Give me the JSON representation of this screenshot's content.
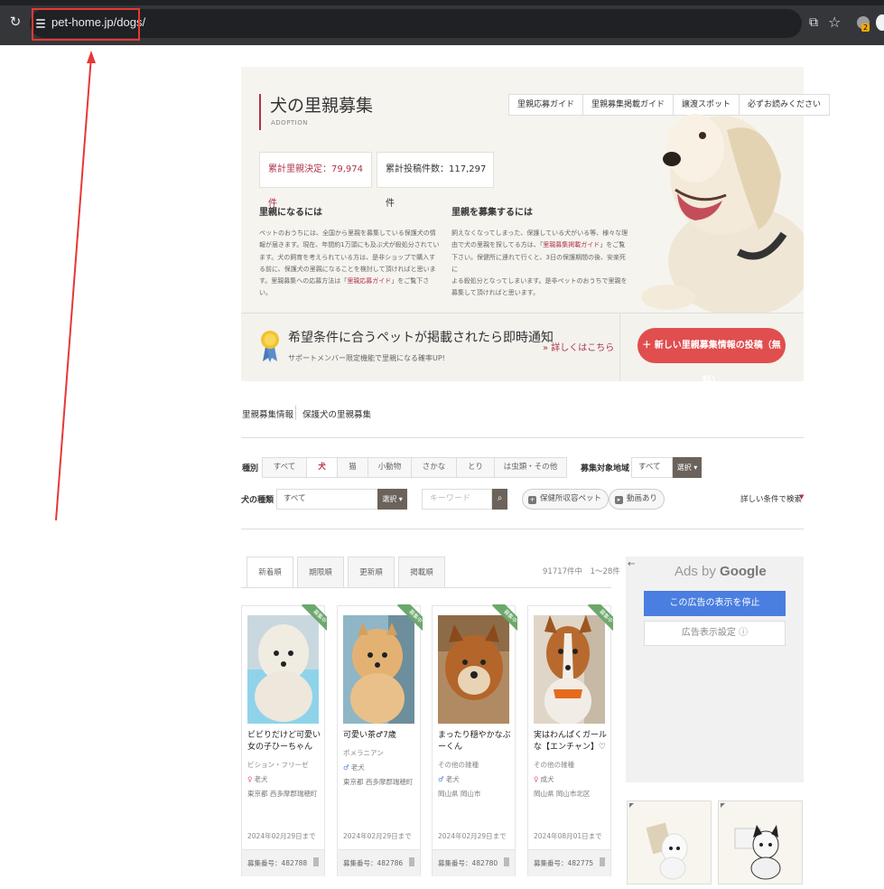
{
  "browser": {
    "url": "pet-home.jp/dogs/",
    "profile_badge": "2"
  },
  "hero": {
    "title": "犬の里親募集",
    "subtitle": "ADOPTION",
    "nav": [
      "里親応募ガイド",
      "里親募集掲載ガイド",
      "譲渡スポット",
      "必ずお読みください"
    ],
    "stat_adopted": "累計里親決定：79,974 件",
    "stat_posts": "累計投稿件数：117,297 件",
    "col1_title": "里親になるには",
    "col1_lines": [
      "ペットのおうちには、全国から里親を募集している保護犬の情",
      "報が届きます。現在、年間約1万頭にも及ぶ犬が殺処分されてい",
      "ます。犬の飼育を考えられている方は、是非ショップで購入す",
      "る前に、保護犬の里親になることを検討して頂ければと思いま",
      "す。里親募集への応募方法は「",
      "」をご覧下さ",
      "い。"
    ],
    "col1_link": "里親応募ガイド",
    "col2_title": "里親を募集するには",
    "col2_lines": [
      "飼えなくなってしまった、保護している犬がいる等、様々な理",
      "由で犬の里親を探してる方は、「",
      "」をご覧",
      "下さい。保健所に連れて行くと、3日の保護期間の後、安楽死に",
      "よる殺処分となってしまいます。是非ペットのおうちで里親を",
      "募集して頂ければと思います。"
    ],
    "col2_link": "里親募集掲載ガイド"
  },
  "notify": {
    "title": "希望条件に合うペットが掲載されたら即時通知",
    "sub": "サポートメンバー限定機能で里親になる確率UP!",
    "link": "» 詳しくはこちら",
    "post_button": "＋ 新しい里親募集情報の投稿（無料）"
  },
  "breadcrumb": [
    "里親募集情報",
    "保護犬の里親募集"
  ],
  "filters": {
    "species_label": "種別",
    "species": [
      "すべて",
      "犬",
      "猫",
      "小動物",
      "さかな",
      "とり",
      "は虫類・その他"
    ],
    "species_selected": "犬",
    "region_label": "募集対象地域",
    "region_value": "すべて",
    "select_label": "選択 ▾",
    "breed_label": "犬の種類",
    "breed_value": "すべて",
    "keyword_placeholder": "キーワード",
    "chip_shelter": "保健所収容ペット",
    "chip_video": "動画あり",
    "detail_search": "詳しい条件で検索",
    "detail_arrow": "▼"
  },
  "tabs": [
    "新着順",
    "期限順",
    "更新順",
    "掲載順"
  ],
  "active_tab": "新着順",
  "result_count": "91717件中　1〜28件",
  "ribbon": "募集中",
  "cards": [
    {
      "title": "ビビりだけど可愛い女の子ひーちゃん",
      "breed": "ビション・フリーゼ",
      "sex": "♀",
      "age": "老犬",
      "location": "東京都 西多摩郡瑞穂町",
      "deadline": "2024年02月29日まで",
      "number": "募集番号：482788"
    },
    {
      "title": "可愛い茶♂7歳",
      "breed": "ポメラニアン",
      "sex": "♂",
      "age": "老犬",
      "location": "東京都 西多摩郡瑞穂町",
      "deadline": "2024年02月29日まで",
      "number": "募集番号：482786"
    },
    {
      "title": "まったり穏やかなぶーくん",
      "breed": "その他の雑種",
      "sex": "♂",
      "age": "老犬",
      "location": "岡山県 岡山市",
      "deadline": "2024年02月29日まで",
      "number": "募集番号：482780"
    },
    {
      "title": "実はわんぱくガールな【エンチャン】♡",
      "breed": "その他の雑種",
      "sex": "♀",
      "age": "成犬",
      "location": "岡山県 岡山市北区",
      "deadline": "2024年08月01日まで",
      "number": "募集番号：482775"
    }
  ],
  "ad": {
    "back": "←",
    "title_prefix": "Ads by ",
    "title_brand": "Google",
    "stop": "この広告の表示を停止",
    "settings": "広告表示設定 ⓘ"
  },
  "colors": {
    "accent": "#b0334a",
    "cta": "#e04e4e",
    "ribbon": "#6ca86c",
    "annotation": "#e53935"
  }
}
